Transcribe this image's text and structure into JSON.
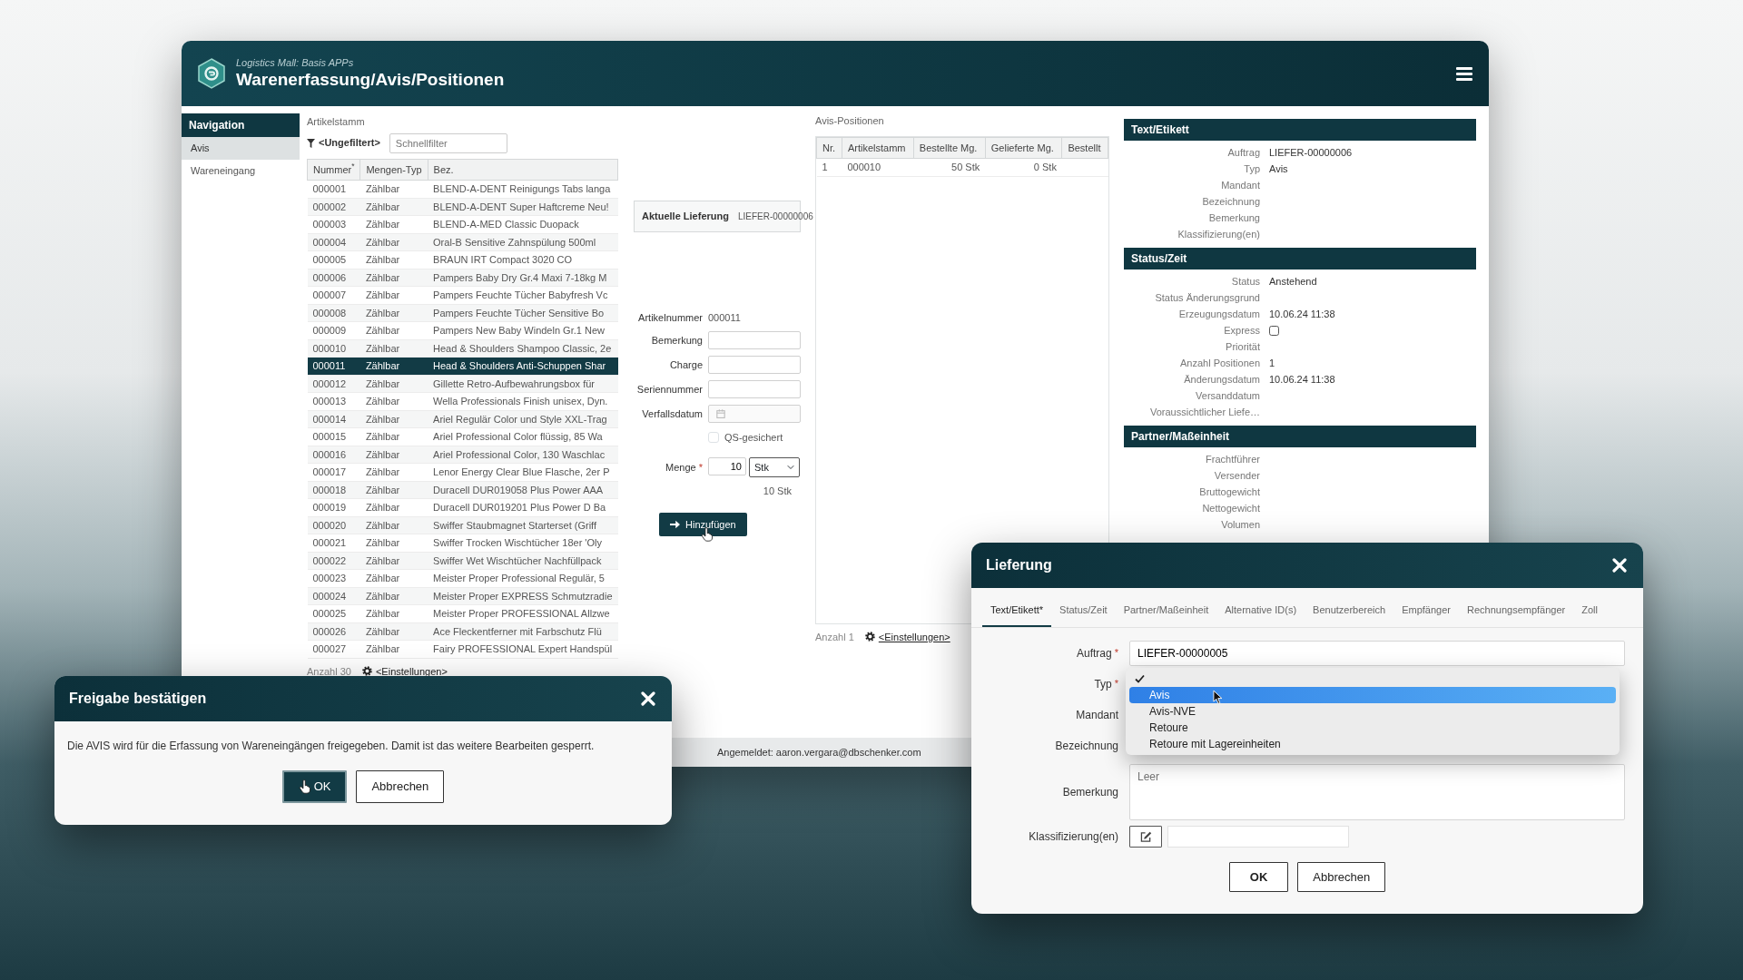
{
  "main_window": {
    "header": {
      "subtitle": "Logistics Mall: Basis APPs",
      "title": "Warenerfassung/Avis/Positionen"
    },
    "navigation": {
      "title": "Navigation",
      "items": [
        {
          "label": "Avis",
          "selected": true
        },
        {
          "label": "Wareneingang",
          "selected": false
        }
      ]
    },
    "artikelstamm": {
      "title": "Artikelstamm",
      "filter": "<Ungefiltert>",
      "search": {
        "placeholder": "Schnellfilter"
      },
      "columns": [
        "Nummer$^{*}$",
        "Mengen-Typ",
        "Bez."
      ],
      "rows": [
        {
          "cells": [
            "000001",
            "Zählbar",
            "BLEND-A-DENT Reinigungs Tabs langa"
          ],
          "selected": false
        },
        {
          "cells": [
            "000002",
            "Zählbar",
            "BLEND-A-DENT Super Haftcreme Neu!"
          ],
          "selected": false
        },
        {
          "cells": [
            "000003",
            "Zählbar",
            "BLEND-A-MED Classic Duopack"
          ],
          "selected": false
        },
        {
          "cells": [
            "000004",
            "Zählbar",
            "Oral-B Sensitive Zahnspülung 500ml"
          ],
          "selected": false
        },
        {
          "cells": [
            "000005",
            "Zählbar",
            "BRAUN IRT Compact 3020 CO"
          ],
          "selected": false
        },
        {
          "cells": [
            "000006",
            "Zählbar",
            "Pampers Baby Dry Gr.4 Maxi 7-18kg M"
          ],
          "selected": false
        },
        {
          "cells": [
            "000007",
            "Zählbar",
            "Pampers Feuchte Tücher Babyfresh Vc"
          ],
          "selected": false
        },
        {
          "cells": [
            "000008",
            "Zählbar",
            "Pampers Feuchte Tücher Sensitive Bo"
          ],
          "selected": false
        },
        {
          "cells": [
            "000009",
            "Zählbar",
            "Pampers New Baby Windeln Gr.1 New"
          ],
          "selected": false
        },
        {
          "cells": [
            "000010",
            "Zählbar",
            "Head & Shoulders Shampoo Classic, 2e"
          ],
          "selected": false
        },
        {
          "cells": [
            "000011",
            "Zählbar",
            "Head & Shoulders Anti-Schuppen Shar"
          ],
          "selected": true
        },
        {
          "cells": [
            "000012",
            "Zählbar",
            "Gillette Retro-Aufbewahrungsbox für"
          ],
          "selected": false
        },
        {
          "cells": [
            "000013",
            "Zählbar",
            "Wella Professionals Finish unisex, Dyn."
          ],
          "selected": false
        },
        {
          "cells": [
            "000014",
            "Zählbar",
            "Ariel Regulär Color und Style XXL-Trag"
          ],
          "selected": false
        },
        {
          "cells": [
            "000015",
            "Zählbar",
            "Ariel Professional Color flüssig, 85 Wa"
          ],
          "selected": false
        },
        {
          "cells": [
            "000016",
            "Zählbar",
            "Ariel Professional Color, 130 Waschlac"
          ],
          "selected": false
        },
        {
          "cells": [
            "000017",
            "Zählbar",
            "Lenor Energy Clear Blue Flasche, 2er P"
          ],
          "selected": false
        },
        {
          "cells": [
            "000018",
            "Zählbar",
            "Duracell DUR019058 Plus Power AAA"
          ],
          "selected": false
        },
        {
          "cells": [
            "000019",
            "Zählbar",
            "Duracell DUR019201 Plus Power D Ba"
          ],
          "selected": false
        },
        {
          "cells": [
            "000020",
            "Zählbar",
            "Swiffer Staubmagnet Starterset (Griff"
          ],
          "selected": false
        },
        {
          "cells": [
            "000021",
            "Zählbar",
            "Swiffer Trocken Wischtücher 18er 'Oly"
          ],
          "selected": false
        },
        {
          "cells": [
            "000022",
            "Zählbar",
            "Swiffer Wet Wischtücher Nachfüllpack"
          ],
          "selected": false
        },
        {
          "cells": [
            "000023",
            "Zählbar",
            "Meister Proper Professional Regulär, 5"
          ],
          "selected": false
        },
        {
          "cells": [
            "000024",
            "Zählbar",
            "Meister Proper EXPRESS Schmutzradie"
          ],
          "selected": false
        },
        {
          "cells": [
            "000025",
            "Zählbar",
            "Meister Proper PROFESSIONAL Allzwe"
          ],
          "selected": false
        },
        {
          "cells": [
            "000026",
            "Zählbar",
            "Ace Fleckentferner mit Farbschutz Flü"
          ],
          "selected": false
        },
        {
          "cells": [
            "000027",
            "Zählbar",
            "Fairy PROFESSIONAL Expert Handspül"
          ],
          "selected": false
        }
      ],
      "count": "Anzahl 30",
      "settings": "<Einstellungen>"
    },
    "current_delivery": {
      "label": "Aktuelle Lieferung",
      "value": "LIEFER-00000006"
    },
    "position_form": {
      "fields": [
        {
          "kind": "text",
          "label": "Artikelnummer",
          "value": "000011"
        },
        {
          "kind": "input",
          "label": "Bemerkung"
        },
        {
          "kind": "input",
          "label": "Charge"
        },
        {
          "kind": "input",
          "label": "Seriennummer"
        },
        {
          "kind": "date",
          "label": "Verfallsdatum"
        },
        {
          "kind": "checkbox",
          "label": "QS-gesichert",
          "checked": false
        },
        {
          "kind": "quantity",
          "label": "Menge",
          "required_mark": "*",
          "value": "10",
          "unit": "Stk",
          "summary": "10 Stk"
        }
      ],
      "button": "Hinzufügen"
    },
    "avis_positionen": {
      "title": "Avis-Positionen",
      "columns": [
        "Nr.",
        "Artikelstamm",
        "Bestellte Mg.",
        "Gelieferte Mg.",
        "Bestellt"
      ],
      "rows": [
        {
          "cells": [
            "1",
            "000010",
            "50 Stk",
            "0 Stk"
          ],
          "selected": false
        }
      ],
      "count": "Anzahl 1",
      "settings": "<Einstellungen>"
    },
    "details": {
      "sections": [
        {
          "title": "Text/Etikett",
          "rows": [
            {
              "kind": "text",
              "label": "Auftrag",
              "value": "LIEFER-00000006"
            },
            {
              "kind": "text",
              "label": "Typ",
              "value": "Avis"
            },
            {
              "kind": "text",
              "label": "Mandant"
            },
            {
              "kind": "text",
              "label": "Bezeichnung"
            },
            {
              "kind": "text",
              "label": "Bemerkung"
            },
            {
              "kind": "text",
              "label": "Klassifizierung(en)"
            }
          ]
        },
        {
          "title": "Status/Zeit",
          "rows": [
            {
              "kind": "text",
              "label": "Status",
              "value": "Anstehend"
            },
            {
              "kind": "text",
              "label": "Status Änderungsgrund"
            },
            {
              "kind": "text",
              "label": "Erzeugungsdatum",
              "value": "10.06.24 11:38"
            },
            {
              "kind": "checkbox",
              "label": "Express",
              "checked": false
            },
            {
              "kind": "text",
              "label": "Priorität"
            },
            {
              "kind": "text",
              "label": "Anzahl Positionen",
              "value": "1"
            },
            {
              "kind": "text",
              "label": "Änderungsdatum",
              "value": "10.06.24 11:38"
            },
            {
              "kind": "text",
              "label": "Versanddatum"
            },
            {
              "kind": "text",
              "label": "Voraussichtlicher Liefe…"
            }
          ]
        },
        {
          "title": "Partner/Maßeinheit",
          "rows": [
            {
              "kind": "text",
              "label": "Frachtführer"
            },
            {
              "kind": "text",
              "label": "Versender"
            },
            {
              "kind": "text",
              "label": "Bruttogewicht"
            },
            {
              "kind": "text",
              "label": "Nettogewicht"
            },
            {
              "kind": "text",
              "label": "Volumen"
            }
          ]
        }
      ]
    },
    "status_bar": "Angemeldet: aaron.vergara@dbschenker.com"
  },
  "confirm_dialog": {
    "title": "Freigabe bestätigen",
    "message": "Die AVIS wird für die Erfassung von Wareneingängen freigegeben. Damit ist das weitere Bearbeiten gesperrt.",
    "buttons": [
      {
        "label": "OK",
        "kind": "primary"
      },
      {
        "label": "Abbrechen",
        "kind": "secondary"
      }
    ]
  },
  "delivery_dialog": {
    "title": "Lieferung",
    "tabs": [
      {
        "label": "Text/Etikett*",
        "selected": true
      },
      {
        "label": "Status/Zeit",
        "selected": false
      },
      {
        "label": "Partner/Maßeinheit",
        "selected": false
      },
      {
        "label": "Alternative ID(s)",
        "selected": false
      },
      {
        "label": "Benutzerbereich",
        "selected": false
      },
      {
        "label": "Empfänger",
        "selected": false
      },
      {
        "label": "Rechnungsempfänger",
        "selected": false
      },
      {
        "label": "Zoll",
        "selected": false
      }
    ],
    "fields": [
      {
        "kind": "input",
        "label": "Auftrag",
        "required_mark": "*",
        "value": "LIEFER-00000005"
      },
      {
        "kind": "select",
        "label": "Typ",
        "required_mark": "*",
        "menu": [
          {
            "checked": true,
            "hovered": false
          },
          {
            "label": "Avis",
            "checked": false,
            "hovered": true
          },
          {
            "label": "Avis-NVE",
            "checked": false,
            "hovered": false
          },
          {
            "label": "Retoure",
            "checked": false,
            "hovered": false
          },
          {
            "label": "Retoure mit Lagereinheiten",
            "checked": false,
            "hovered": false
          }
        ]
      },
      {
        "kind": "label_only",
        "label": "Mandant"
      },
      {
        "kind": "label_only",
        "label": "Bezeichnung"
      },
      {
        "kind": "textarea",
        "label": "Bemerkung",
        "placeholder": "Leer"
      },
      {
        "kind": "edit",
        "label": "Klassifizierung(en)"
      }
    ],
    "buttons": [
      {
        "label": "OK",
        "kind": "default"
      },
      {
        "label": "Abbrechen",
        "kind": "secondary"
      }
    ]
  }
}
